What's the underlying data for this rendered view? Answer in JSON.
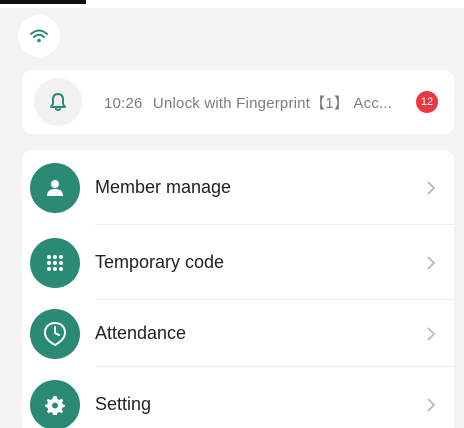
{
  "status": {
    "wifi_icon": "wifi-icon"
  },
  "notification": {
    "icon": "bell-icon",
    "time": "10:26",
    "message": "Unlock with Fingerprint【1】 Acc...",
    "count": "12",
    "badge_color": "#e9383f"
  },
  "menu": {
    "accent_color": "#2a8a74",
    "items": [
      {
        "label": "Member manage",
        "icon": "person-icon"
      },
      {
        "label": "Temporary code",
        "icon": "keypad-icon"
      },
      {
        "label": "Attendance",
        "icon": "clock-icon"
      },
      {
        "label": "Setting",
        "icon": "gear-icon"
      }
    ]
  }
}
